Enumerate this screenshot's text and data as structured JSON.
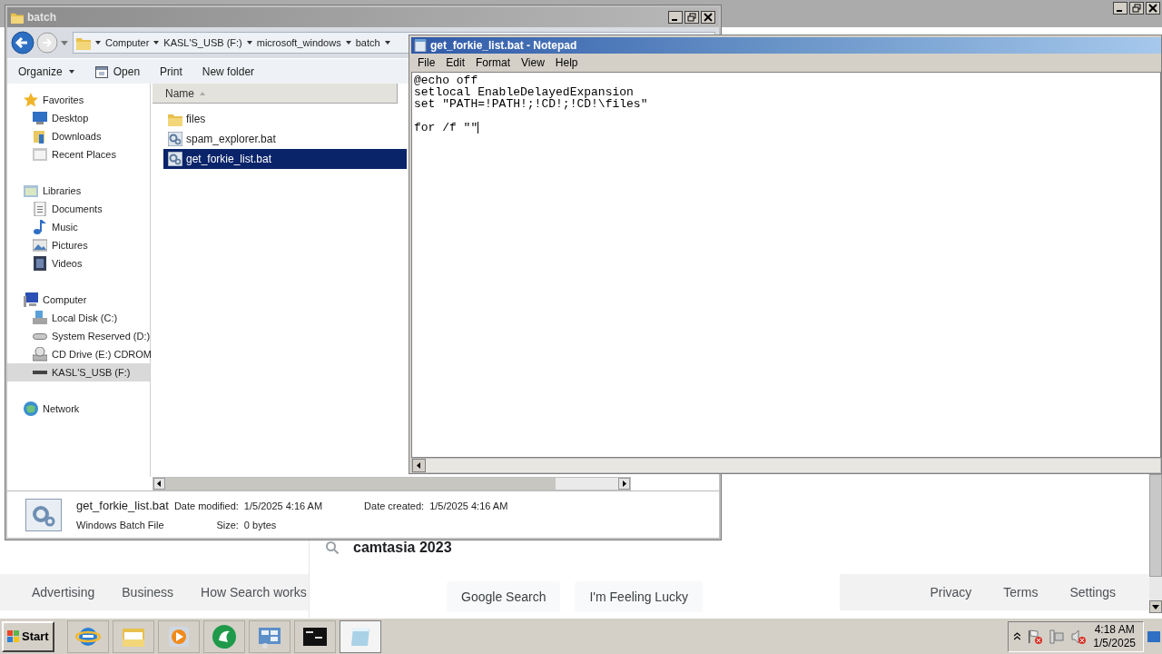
{
  "browser": {
    "search_query": "camtasia 2023",
    "search_buttons": [
      "Google Search",
      "I'm Feeling Lucky"
    ],
    "footer_left": [
      "Advertising",
      "Business",
      "How Search works"
    ],
    "footer_right": [
      "Privacy",
      "Terms",
      "Settings"
    ]
  },
  "explorer": {
    "title": "batch",
    "breadcrumb": [
      "Computer",
      "KASL'S_USB (F:)",
      "microsoft_windows",
      "batch"
    ],
    "toolbar": [
      {
        "label": "Organize",
        "kind": "menu"
      },
      {
        "label": "Open",
        "kind": "icon"
      },
      {
        "label": "Print",
        "kind": "plain"
      },
      {
        "label": "New folder",
        "kind": "plain"
      }
    ],
    "nav": [
      {
        "label": "Favorites",
        "kind": "star",
        "selected": false,
        "children": [
          {
            "label": "Desktop",
            "kind": "desktop",
            "selected": false
          },
          {
            "label": "Downloads",
            "kind": "downloads",
            "selected": false
          },
          {
            "label": "Recent Places",
            "kind": "recent",
            "selected": false
          }
        ]
      },
      {
        "label": "Libraries",
        "kind": "libraries",
        "selected": false,
        "children": [
          {
            "label": "Documents",
            "kind": "documents",
            "selected": false
          },
          {
            "label": "Music",
            "kind": "music",
            "selected": false
          },
          {
            "label": "Pictures",
            "kind": "pictures",
            "selected": false
          },
          {
            "label": "Videos",
            "kind": "videos",
            "selected": false
          }
        ]
      },
      {
        "label": "Computer",
        "kind": "computer",
        "selected": false,
        "children": [
          {
            "label": "Local Disk (C:)",
            "kind": "disk",
            "selected": false
          },
          {
            "label": "System Reserved (D:)",
            "kind": "drive",
            "selected": false
          },
          {
            "label": "CD Drive (E:) CDROM",
            "kind": "cdrom",
            "selected": false
          },
          {
            "label": "KASL'S_USB (F:)",
            "kind": "usb",
            "selected": true
          }
        ]
      },
      {
        "label": "Network",
        "kind": "network",
        "selected": false
      }
    ],
    "column": "Name",
    "files": [
      {
        "name": "files",
        "kind": "folder",
        "selected": false
      },
      {
        "name": "spam_explorer.bat",
        "kind": "batch",
        "selected": false
      },
      {
        "name": "get_forkie_list.bat",
        "kind": "batch",
        "selected": true
      }
    ],
    "details": {
      "name": "get_forkie_list.bat",
      "type": "Windows Batch File",
      "modified_label": "Date modified:",
      "modified": "1/5/2025 4:16 AM",
      "created_label": "Date created:",
      "created": "1/5/2025 4:16 AM",
      "size_label": "Size:",
      "size": "0 bytes"
    }
  },
  "notepad": {
    "title": "get_forkie_list.bat - Notepad",
    "menu": [
      "File",
      "Edit",
      "Format",
      "View",
      "Help"
    ],
    "text": "@echo off\nsetlocal EnableDelayedExpansion\nset \"PATH=!PATH!;!CD!;!CD!\\files\"\n\nfor /f \"\""
  },
  "taskbar": {
    "start": "Start",
    "apps": [
      {
        "kind": "browser",
        "selected": false
      },
      {
        "kind": "folder",
        "selected": false
      },
      {
        "kind": "media",
        "selected": false
      },
      {
        "kind": "green",
        "selected": false
      },
      {
        "kind": "panel",
        "selected": false
      },
      {
        "kind": "terminal",
        "selected": false
      },
      {
        "kind": "notepad",
        "selected": true
      }
    ],
    "clock_time": "4:18 AM",
    "clock_date": "1/5/2025"
  }
}
